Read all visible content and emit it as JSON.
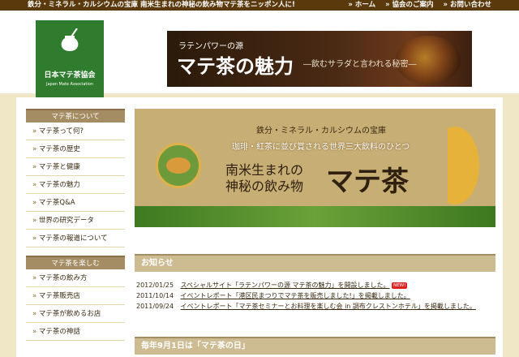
{
  "topbar": {
    "tagline": "鉄分・ミネラル・カルシウムの宝庫 南米生まれの神秘の飲み物マテ茶をニッポン人に!",
    "nav": [
      {
        "label": "» ホーム"
      },
      {
        "label": "» 協会のご案内"
      },
      {
        "label": "» お問い合わせ"
      }
    ]
  },
  "logo": {
    "name": "日本マテ茶協会",
    "english": "Japan Mate Association"
  },
  "banner": {
    "subtitle": "ラテンパワーの源",
    "title": "マテ茶の魅力",
    "tagline": "―飲むサラダと言われる秘密―"
  },
  "sidebar": {
    "section1": {
      "heading": "マテ茶について",
      "items": [
        "マテ茶って何?",
        "マテ茶の歴史",
        "マテ茶と健康",
        "マテ茶の魅力",
        "マテ茶Q&A",
        "世界の研究データ",
        "マテ茶の報道について"
      ]
    },
    "section2": {
      "heading": "マテ茶を楽しむ",
      "items": [
        "マテ茶の飲み方",
        "マテ茶販売店",
        "マテ茶が飲めるお店",
        "マテ茶の神話"
      ]
    }
  },
  "hero": {
    "line1": "鉄分・ミネラル・カルシウムの宝庫",
    "line2": "珈琲・紅茶に並び賞される世界三大飲料のひとつ",
    "line3": "南米生まれの",
    "line4": "神秘の飲み物",
    "big": "マテ茶"
  },
  "news": {
    "heading": "お知らせ",
    "items": [
      {
        "date": "2012/01/25",
        "text": "スペシャルサイト「ラテンパワーの源 マテ茶の魅力」を開設しました。",
        "badge": "NEW!"
      },
      {
        "date": "2011/10/14",
        "text": "イベントレポート「港区民まつりでマテ茶を販売しました!」を掲載しました。",
        "badge": ""
      },
      {
        "date": "2011/09/24",
        "text": "イベントレポート「マテ茶セミナーとお料理を楽しむ会 in 調布クレストンホテル」を掲載しました。",
        "badge": ""
      }
    ]
  },
  "mateday": {
    "heading": "毎年9月1日は「マテ茶の日」"
  }
}
